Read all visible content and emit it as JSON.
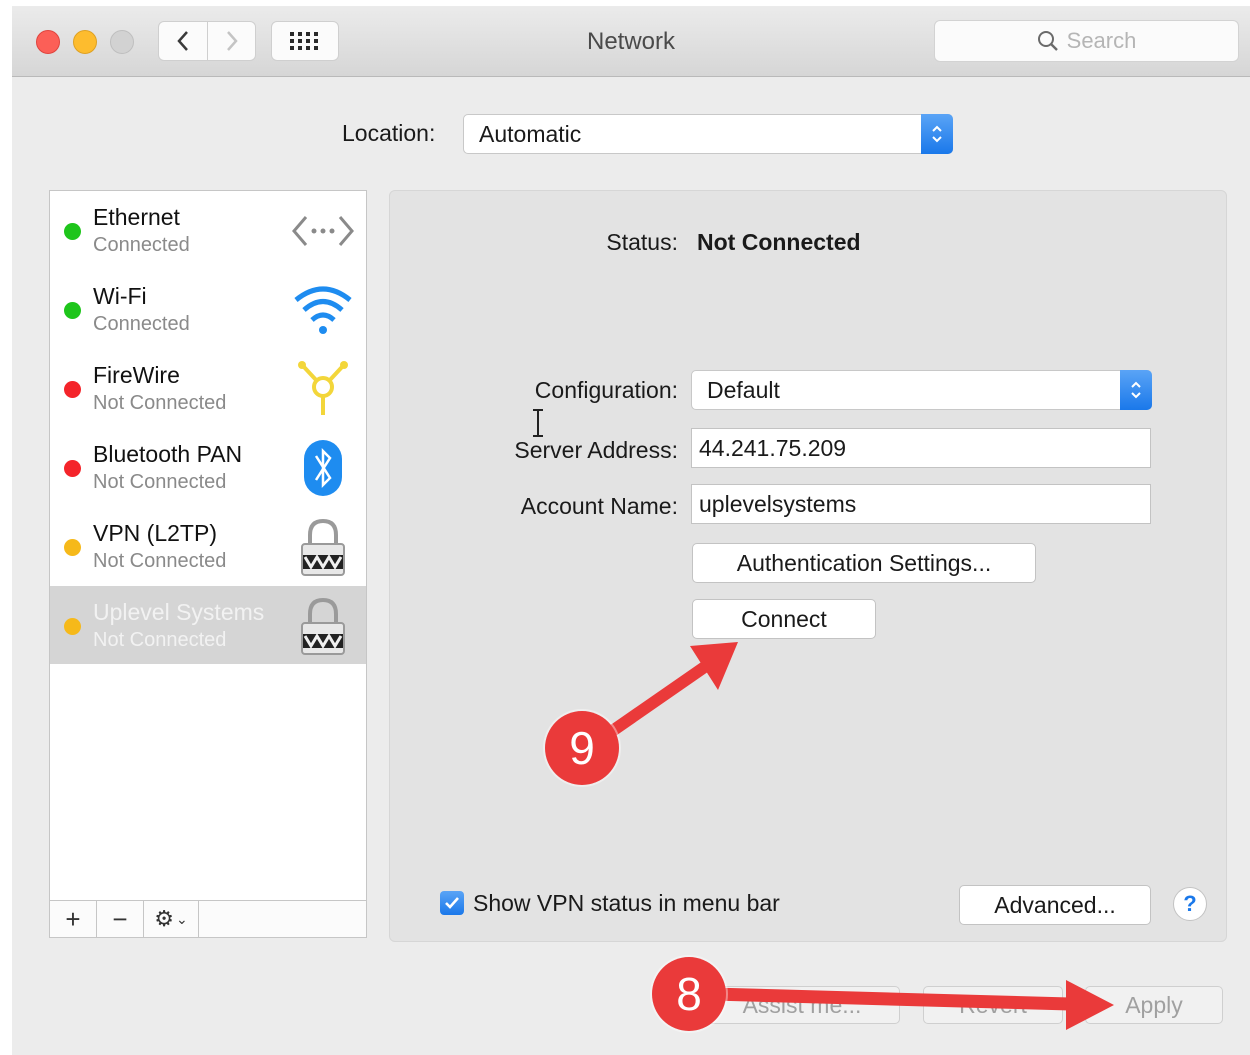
{
  "window": {
    "title": "Network"
  },
  "search": {
    "placeholder": "Search"
  },
  "location": {
    "label": "Location:",
    "value": "Automatic"
  },
  "services": [
    {
      "name": "Ethernet",
      "status": "Connected",
      "dot": "green",
      "icon": "ethernet-icon"
    },
    {
      "name": "Wi-Fi",
      "status": "Connected",
      "dot": "green",
      "icon": "wifi-icon"
    },
    {
      "name": "FireWire",
      "status": "Not Connected",
      "dot": "red",
      "icon": "firewire-icon"
    },
    {
      "name": "Bluetooth PAN",
      "status": "Not Connected",
      "dot": "red",
      "icon": "bluetooth-icon"
    },
    {
      "name": "VPN (L2TP)",
      "status": "Not Connected",
      "dot": "yellow",
      "icon": "lock-icon"
    },
    {
      "name": "Uplevel Systems",
      "status": "Not Connected",
      "dot": "yellow",
      "icon": "lock-icon",
      "selected": true
    }
  ],
  "sidebar_tools": {
    "add": "+",
    "remove": "−"
  },
  "detail": {
    "status_label": "Status:",
    "status_value": "Not Connected",
    "configuration_label": "Configuration:",
    "configuration_value": "Default",
    "server_label": "Server Address:",
    "server_value": "44.241.75.209",
    "account_label": "Account Name:",
    "account_value": "uplevelsystems",
    "auth_button": "Authentication Settings...",
    "connect_button": "Connect",
    "show_vpn_label": "Show VPN status in menu bar",
    "show_vpn_checked": true,
    "advanced_button": "Advanced...",
    "help_button": "?"
  },
  "bottom": {
    "assist_button": "Assist me...",
    "revert_button": "Revert",
    "apply_button": "Apply"
  },
  "annotations": [
    {
      "number": "9",
      "color": "#ea3a3a"
    },
    {
      "number": "8",
      "color": "#ea3a3a"
    }
  ],
  "colors": {
    "accent": "#1a78ea",
    "annotation": "#ea3a3a",
    "selected_row": "#d5d5d5"
  }
}
